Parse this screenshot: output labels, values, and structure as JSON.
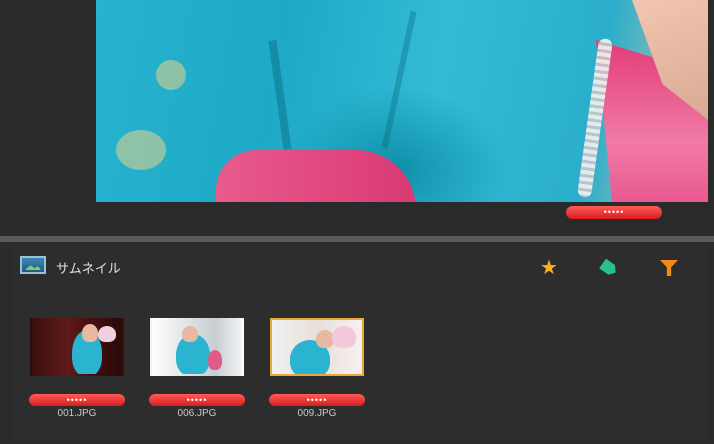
{
  "viewer": {
    "rating_dots": "•••••"
  },
  "thumbnail_panel": {
    "title": "サムネイル",
    "tools": [
      {
        "name": "star",
        "color": "#f7b21c"
      },
      {
        "name": "tag",
        "color": "#28c18a"
      },
      {
        "name": "filter",
        "color": "#f58a16"
      }
    ],
    "items": [
      {
        "filename": "001.JPG",
        "rating_dots": "•••••",
        "selected": false
      },
      {
        "filename": "006.JPG",
        "rating_dots": "•••••",
        "selected": false
      },
      {
        "filename": "009.JPG",
        "rating_dots": "•••••",
        "selected": true
      }
    ]
  },
  "colors": {
    "background": "#2b2b2b",
    "rating_red": "#e52a2a",
    "selection_border": "#e9a93a"
  }
}
